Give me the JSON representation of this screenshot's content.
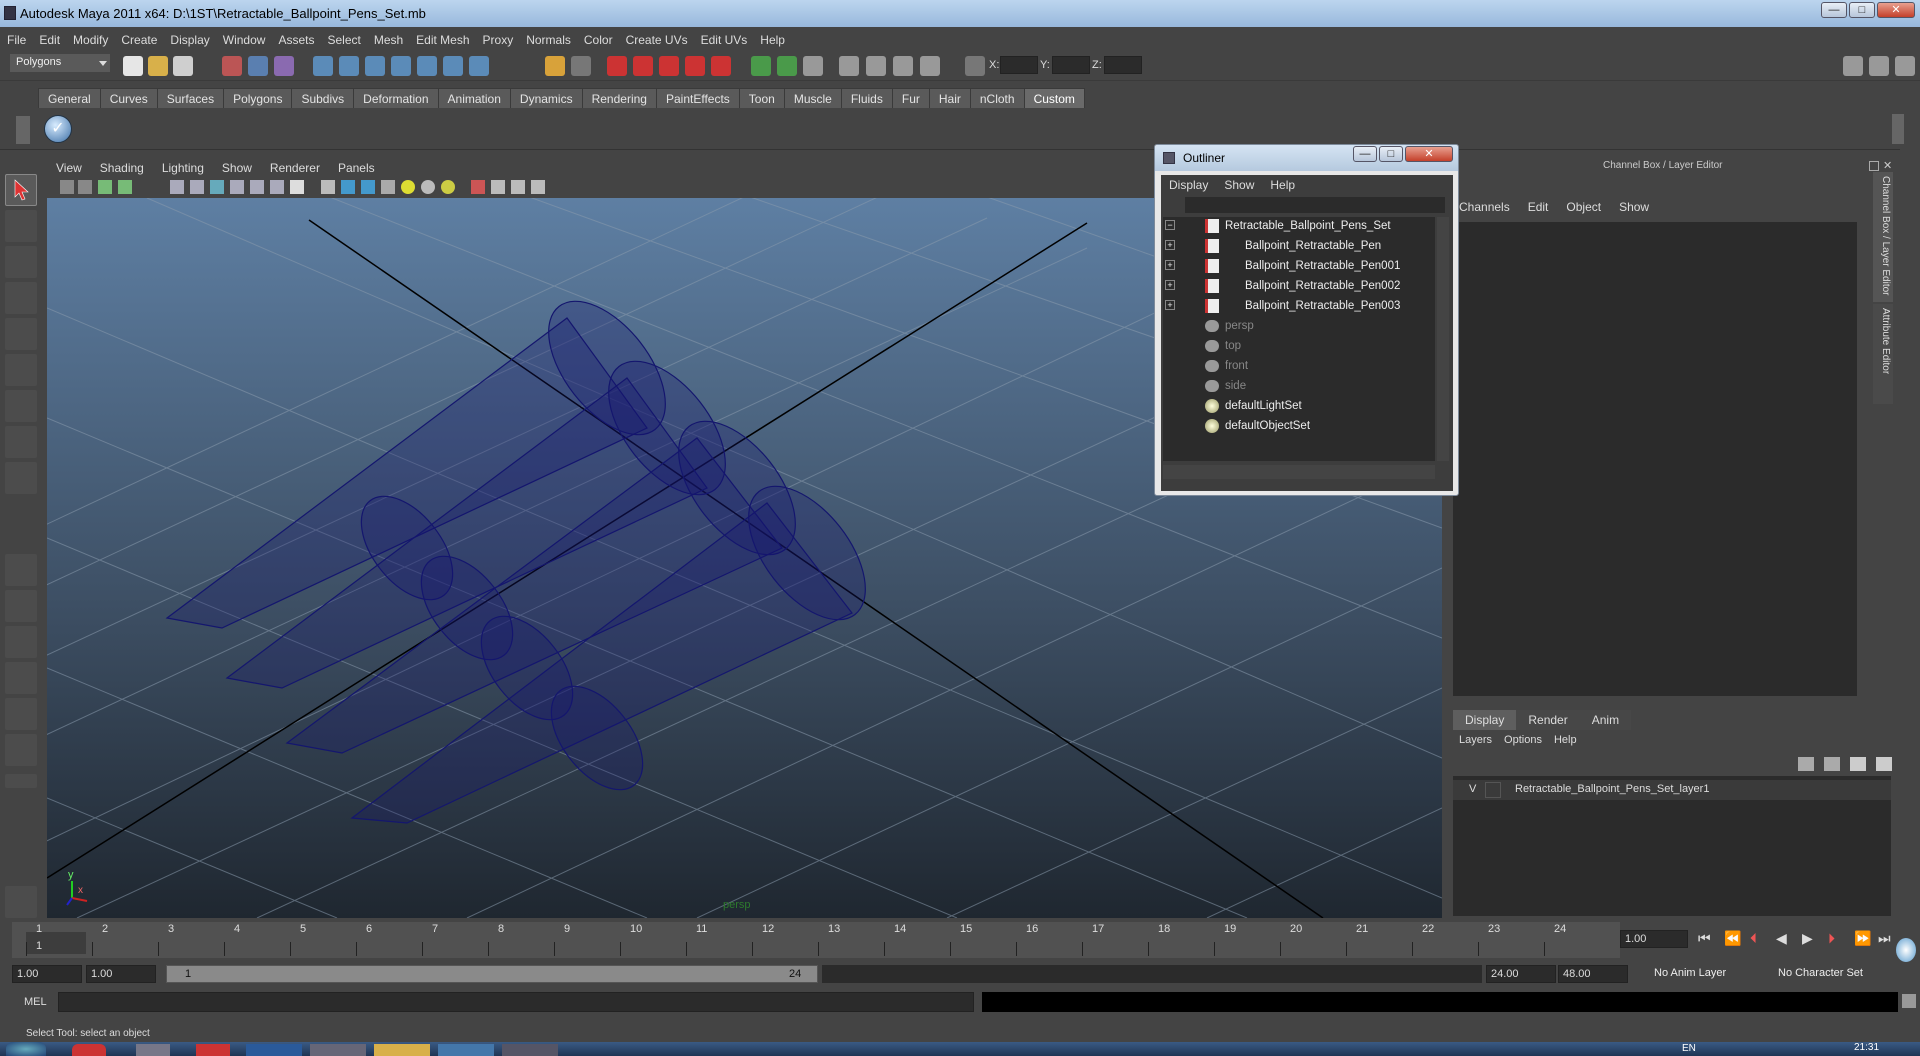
{
  "window": {
    "title": "Autodesk Maya 2011 x64: D:\\1ST\\Retractable_Ballpoint_Pens_Set.mb",
    "minimize": "—",
    "maximize": "□",
    "close": "✕"
  },
  "menu": [
    "File",
    "Edit",
    "Modify",
    "Create",
    "Display",
    "Window",
    "Assets",
    "Select",
    "Mesh",
    "Edit Mesh",
    "Proxy",
    "Normals",
    "Color",
    "Create UVs",
    "Edit UVs",
    "Help"
  ],
  "toolbar": {
    "mode": "Polygons",
    "x_label": "X:",
    "y_label": "Y:",
    "z_label": "Z:"
  },
  "shelf_tabs": [
    "General",
    "Curves",
    "Surfaces",
    "Polygons",
    "Subdivs",
    "Deformation",
    "Animation",
    "Dynamics",
    "Rendering",
    "PaintEffects",
    "Toon",
    "Muscle",
    "Fluids",
    "Fur",
    "Hair",
    "nCloth",
    "Custom"
  ],
  "shelf_active": "Custom",
  "panel_menu": [
    "View",
    "Shading",
    "Lighting",
    "Show",
    "Renderer",
    "Panels"
  ],
  "viewport": {
    "camera_label": "persp",
    "axis_y": "y",
    "axis_x": "x"
  },
  "outliner": {
    "title": "Outliner",
    "menu": [
      "Display",
      "Show",
      "Help"
    ],
    "items": [
      {
        "label": "Retractable_Ballpoint_Pens_Set",
        "expand": "−",
        "icon": "mesh-icon",
        "dim": false
      },
      {
        "label": "Ballpoint_Retractable_Pen",
        "expand": "+",
        "icon": "mesh-icon",
        "dim": false
      },
      {
        "label": "Ballpoint_Retractable_Pen001",
        "expand": "+",
        "icon": "mesh-icon",
        "dim": false
      },
      {
        "label": "Ballpoint_Retractable_Pen002",
        "expand": "+",
        "icon": "mesh-icon",
        "dim": false
      },
      {
        "label": "Ballpoint_Retractable_Pen003",
        "expand": "+",
        "icon": "mesh-icon",
        "dim": false
      },
      {
        "label": "persp",
        "expand": "",
        "icon": "camera-icon",
        "dim": true
      },
      {
        "label": "top",
        "expand": "",
        "icon": "camera-icon",
        "dim": true
      },
      {
        "label": "front",
        "expand": "",
        "icon": "camera-icon",
        "dim": true
      },
      {
        "label": "side",
        "expand": "",
        "icon": "camera-icon",
        "dim": true
      },
      {
        "label": "defaultLightSet",
        "expand": "",
        "icon": "set-icon",
        "dim": false
      },
      {
        "label": "defaultObjectSet",
        "expand": "",
        "icon": "set-icon",
        "dim": false
      }
    ]
  },
  "channelbox": {
    "header": "Channel Box / Layer Editor",
    "menu": [
      "Channels",
      "Edit",
      "Object",
      "Show"
    ],
    "side_tab_1": "Channel Box / Layer Editor",
    "side_tab_2": "Attribute Editor"
  },
  "layers": {
    "tabs": [
      "Display",
      "Render",
      "Anim"
    ],
    "active_tab": "Display",
    "menu": [
      "Layers",
      "Options",
      "Help"
    ],
    "layer_visibility": "V",
    "layer_name": "Retractable_Ballpoint_Pens_Set_layer1"
  },
  "timeline": {
    "ticks": [
      "1",
      "2",
      "3",
      "4",
      "5",
      "6",
      "7",
      "8",
      "9",
      "10",
      "11",
      "12",
      "13",
      "14",
      "15",
      "16",
      "17",
      "18",
      "19",
      "20",
      "21",
      "22",
      "23",
      "24"
    ],
    "current_frame_marker": "1",
    "current_time": "1.00"
  },
  "range": {
    "start_time": "1.00",
    "playback_start": "1.00",
    "range_start": "1",
    "range_end": "24",
    "playback_end": "24.00",
    "end_time": "48.00",
    "anim_layer": "No Anim Layer",
    "character_set": "No Character Set"
  },
  "command": {
    "label": "MEL",
    "help": "Select Tool: select an object"
  },
  "taskbar": {
    "lang": "EN",
    "clock": "21:31"
  },
  "colors": {
    "wireframe": "#14166e",
    "accent": "#5285a6"
  }
}
